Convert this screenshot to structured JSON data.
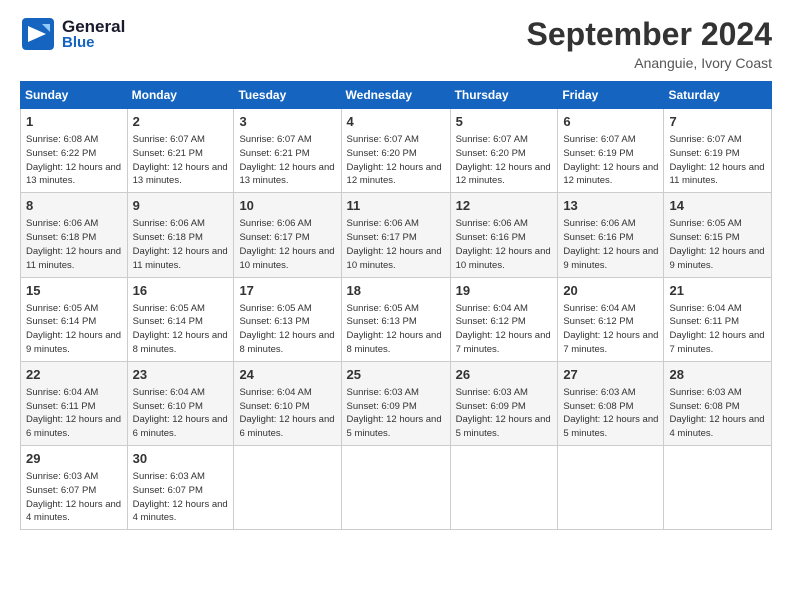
{
  "logo": {
    "line1": "General",
    "line2": "Blue"
  },
  "title": "September 2024",
  "location": "Ananguie, Ivory Coast",
  "days_of_week": [
    "Sunday",
    "Monday",
    "Tuesday",
    "Wednesday",
    "Thursday",
    "Friday",
    "Saturday"
  ],
  "weeks": [
    [
      {
        "day": "1",
        "sunrise": "6:08 AM",
        "sunset": "6:22 PM",
        "daylight": "12 hours and 13 minutes."
      },
      {
        "day": "2",
        "sunrise": "6:07 AM",
        "sunset": "6:21 PM",
        "daylight": "12 hours and 13 minutes."
      },
      {
        "day": "3",
        "sunrise": "6:07 AM",
        "sunset": "6:21 PM",
        "daylight": "12 hours and 13 minutes."
      },
      {
        "day": "4",
        "sunrise": "6:07 AM",
        "sunset": "6:20 PM",
        "daylight": "12 hours and 12 minutes."
      },
      {
        "day": "5",
        "sunrise": "6:07 AM",
        "sunset": "6:20 PM",
        "daylight": "12 hours and 12 minutes."
      },
      {
        "day": "6",
        "sunrise": "6:07 AM",
        "sunset": "6:19 PM",
        "daylight": "12 hours and 12 minutes."
      },
      {
        "day": "7",
        "sunrise": "6:07 AM",
        "sunset": "6:19 PM",
        "daylight": "12 hours and 11 minutes."
      }
    ],
    [
      {
        "day": "8",
        "sunrise": "6:06 AM",
        "sunset": "6:18 PM",
        "daylight": "12 hours and 11 minutes."
      },
      {
        "day": "9",
        "sunrise": "6:06 AM",
        "sunset": "6:18 PM",
        "daylight": "12 hours and 11 minutes."
      },
      {
        "day": "10",
        "sunrise": "6:06 AM",
        "sunset": "6:17 PM",
        "daylight": "12 hours and 10 minutes."
      },
      {
        "day": "11",
        "sunrise": "6:06 AM",
        "sunset": "6:17 PM",
        "daylight": "12 hours and 10 minutes."
      },
      {
        "day": "12",
        "sunrise": "6:06 AM",
        "sunset": "6:16 PM",
        "daylight": "12 hours and 10 minutes."
      },
      {
        "day": "13",
        "sunrise": "6:06 AM",
        "sunset": "6:16 PM",
        "daylight": "12 hours and 9 minutes."
      },
      {
        "day": "14",
        "sunrise": "6:05 AM",
        "sunset": "6:15 PM",
        "daylight": "12 hours and 9 minutes."
      }
    ],
    [
      {
        "day": "15",
        "sunrise": "6:05 AM",
        "sunset": "6:14 PM",
        "daylight": "12 hours and 9 minutes."
      },
      {
        "day": "16",
        "sunrise": "6:05 AM",
        "sunset": "6:14 PM",
        "daylight": "12 hours and 8 minutes."
      },
      {
        "day": "17",
        "sunrise": "6:05 AM",
        "sunset": "6:13 PM",
        "daylight": "12 hours and 8 minutes."
      },
      {
        "day": "18",
        "sunrise": "6:05 AM",
        "sunset": "6:13 PM",
        "daylight": "12 hours and 8 minutes."
      },
      {
        "day": "19",
        "sunrise": "6:04 AM",
        "sunset": "6:12 PM",
        "daylight": "12 hours and 7 minutes."
      },
      {
        "day": "20",
        "sunrise": "6:04 AM",
        "sunset": "6:12 PM",
        "daylight": "12 hours and 7 minutes."
      },
      {
        "day": "21",
        "sunrise": "6:04 AM",
        "sunset": "6:11 PM",
        "daylight": "12 hours and 7 minutes."
      }
    ],
    [
      {
        "day": "22",
        "sunrise": "6:04 AM",
        "sunset": "6:11 PM",
        "daylight": "12 hours and 6 minutes."
      },
      {
        "day": "23",
        "sunrise": "6:04 AM",
        "sunset": "6:10 PM",
        "daylight": "12 hours and 6 minutes."
      },
      {
        "day": "24",
        "sunrise": "6:04 AM",
        "sunset": "6:10 PM",
        "daylight": "12 hours and 6 minutes."
      },
      {
        "day": "25",
        "sunrise": "6:03 AM",
        "sunset": "6:09 PM",
        "daylight": "12 hours and 5 minutes."
      },
      {
        "day": "26",
        "sunrise": "6:03 AM",
        "sunset": "6:09 PM",
        "daylight": "12 hours and 5 minutes."
      },
      {
        "day": "27",
        "sunrise": "6:03 AM",
        "sunset": "6:08 PM",
        "daylight": "12 hours and 5 minutes."
      },
      {
        "day": "28",
        "sunrise": "6:03 AM",
        "sunset": "6:08 PM",
        "daylight": "12 hours and 4 minutes."
      }
    ],
    [
      {
        "day": "29",
        "sunrise": "6:03 AM",
        "sunset": "6:07 PM",
        "daylight": "12 hours and 4 minutes."
      },
      {
        "day": "30",
        "sunrise": "6:03 AM",
        "sunset": "6:07 PM",
        "daylight": "12 hours and 4 minutes."
      },
      null,
      null,
      null,
      null,
      null
    ]
  ]
}
